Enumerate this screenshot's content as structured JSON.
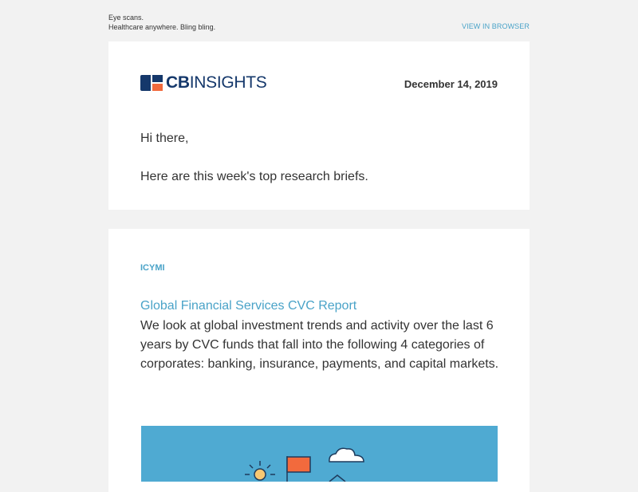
{
  "preheader": {
    "line1": "Eye scans.",
    "line2": "Healthcare anywhere. Bling bling.",
    "view_in_browser": "VIEW IN BROWSER"
  },
  "header": {
    "logo_cb": "CB",
    "logo_insights": "INSIGHTS",
    "date": "December 14, 2019",
    "greeting": "Hi there,",
    "intro": "Here are this week's top research briefs."
  },
  "article": {
    "section": "ICYMI",
    "title": "Global Financial Services CVC Report",
    "description": "We look at global investment trends and activity over the last 6 years by CVC funds that fall into the following 4 categories of corporates: banking, insurance, payments, and capital markets.",
    "hero_icons": [
      "sun-icon",
      "flag-icon",
      "cloud-icon"
    ]
  },
  "colors": {
    "background": "#f2f2f2",
    "card": "#ffffff",
    "link": "#4aa3c8",
    "brand_navy": "#15386b",
    "brand_orange": "#f26a3d",
    "hero_blue": "#4faad2"
  }
}
